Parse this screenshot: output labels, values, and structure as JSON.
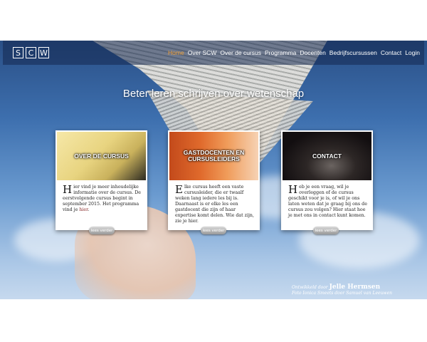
{
  "logo": {
    "letters": [
      "S",
      "C",
      "W"
    ]
  },
  "nav": {
    "items": [
      "Home",
      "Over SCW",
      "Over de cursus",
      "Programma",
      "Docenten",
      "Bedrijfscursussen",
      "Contact",
      "Login"
    ],
    "active": "Home"
  },
  "headline": "Beter leren schrijven over wetenschap",
  "cards": [
    {
      "title": "OVER DE CURSUS",
      "dropcap": "H",
      "text": "ier vind je meer inhoudelijke informatie over de cursus. De eerstvolgende cursus begint in september 2015. Het programma vind je ",
      "link": "hier",
      "text_end": ".",
      "button": "lees verder"
    },
    {
      "title": "GASTDOCENTEN EN CURSUSLEIDERS",
      "dropcap": "E",
      "text": "lke cursus heeft een vaste cursusleider, die er twaalf weken lang iedere les bij is. Daarnaast is er elke les een gastdocent die zijn of haar expertise komt delen. Wie dat zijn, zie je hier.",
      "button": "lees verder"
    },
    {
      "title": "CONTACT",
      "dropcap": "H",
      "text": "eb je een vraag, wil je overleggen of de cursus geschikt voor je is, of wil je ons laten weten dat je graag bij ons de cursus zou volgen? Hier staat hoe je met ons in contact kunt komen.",
      "button": "lees verder"
    }
  ],
  "footer": {
    "developed_by": "Ontwikkeld door",
    "developer": "Jelle Hermsen",
    "photo_credit": "Foto Ionica Smeets door Samuel van Leeuwen"
  }
}
